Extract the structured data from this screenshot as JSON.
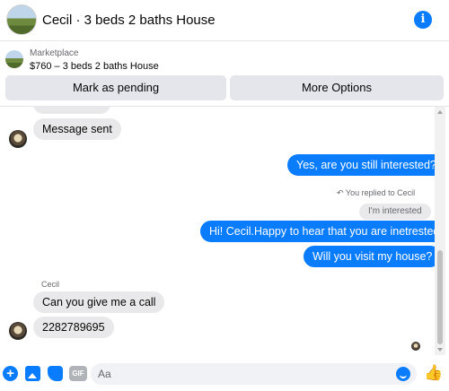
{
  "header": {
    "title": "Cecil · 3 beds 2 baths House",
    "info_icon": "info-icon"
  },
  "marketplace": {
    "label": "Marketplace",
    "listing": "$760 – 3 beds 2 baths House",
    "pending_button": "Mark as pending",
    "more_button": "More Options"
  },
  "messages": {
    "m1": "Message sent",
    "m2": "Yes, are you still interested?",
    "reply_note": "You replied to Cecil",
    "quoted": "I'm interested",
    "m3": "Hi! Cecil.Happy to hear that you are inetrested.",
    "m4": "Will you visit my house?",
    "sender_name": "Cecil",
    "m5": "Can you give me a call",
    "m6": "2282789695"
  },
  "composer": {
    "placeholder": "Aa",
    "value": ""
  },
  "colors": {
    "accent": "#0a7cff",
    "incoming_bubble": "#e9e9eb",
    "text_secondary": "#65676b"
  }
}
